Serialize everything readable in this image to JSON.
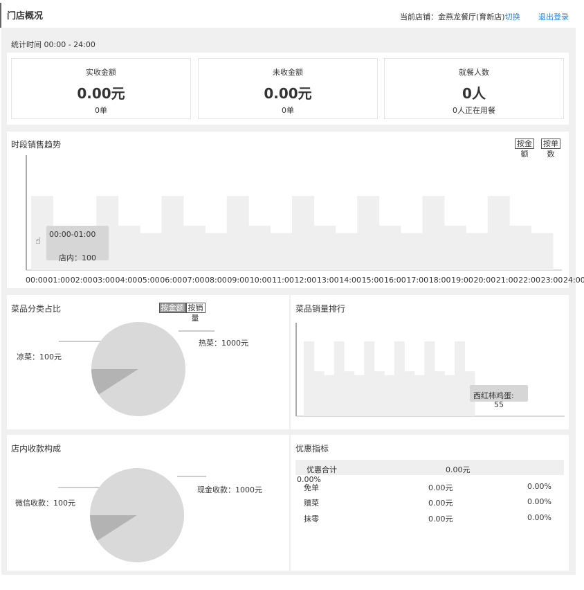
{
  "header": {
    "title": "门店概况",
    "store_label": "当前店铺：金燕龙餐厅(育新店)",
    "switch_label": "切换",
    "logout_label": "退出登录"
  },
  "stats": {
    "time_range": "统计时间 00:00 - 24:00",
    "cards": [
      {
        "title": "实收金额",
        "value": "0.00元",
        "sub": "0单"
      },
      {
        "title": "未收金额",
        "value": "0.00元",
        "sub": "0单"
      },
      {
        "title": "就餐人数",
        "value": "0人",
        "sub": "0人正在用餐"
      }
    ]
  },
  "trend": {
    "title": "时段销售趋势",
    "toggle_amount": "按金额",
    "toggle_count": "按单数",
    "tooltip_time": "00:00-01:00",
    "tooltip_value": "店内：100",
    "chart_data": {
      "type": "bar",
      "categories": [
        "00:00",
        "01:00",
        "02:00",
        "03:00",
        "04:00",
        "05:00",
        "06:00",
        "07:00",
        "08:00",
        "09:00",
        "10:00",
        "11:00",
        "12:00",
        "13:00",
        "14:00",
        "15:00",
        "16:00",
        "17:00",
        "18:00",
        "19:00",
        "20:00",
        "21:00",
        "22:00",
        "23:00"
      ],
      "values": [
        100,
        60,
        50,
        100,
        60,
        50,
        100,
        60,
        50,
        100,
        60,
        50,
        100,
        60,
        50,
        100,
        60,
        50,
        100,
        60,
        50,
        100,
        60,
        50
      ],
      "x_ticks": [
        "00:00",
        "01:00",
        "02:00",
        "03:00",
        "04:00",
        "05:00",
        "06:00",
        "07:00",
        "08:00",
        "09:00",
        "10:00",
        "11:00",
        "12:00",
        "13:00",
        "14:00",
        "15:00",
        "16:00",
        "17:00",
        "18:00",
        "19:00",
        "20:00",
        "21:00",
        "22:00",
        "23:00",
        "24:00"
      ]
    }
  },
  "category": {
    "title": "菜品分类占比",
    "toggle_amount": "按金额",
    "toggle_qty": "按销量",
    "chart_data": {
      "type": "pie",
      "labels": [
        "热菜：1000元",
        "凉菜：100元"
      ],
      "values": [
        1000,
        100
      ]
    }
  },
  "ranking": {
    "title": "菜品销量排行",
    "tooltip_name": "西红柿鸡蛋:",
    "tooltip_value": "55",
    "chart_data": {
      "type": "bar",
      "values": [
        100,
        60,
        55,
        100,
        60,
        55,
        100,
        60,
        55,
        100,
        60,
        55,
        100,
        60,
        55,
        100,
        60
      ]
    }
  },
  "payment": {
    "title": "店内收款构成",
    "chart_data": {
      "type": "pie",
      "labels": [
        "现金收款：1000元",
        "微信收款：100元"
      ],
      "values": [
        1000,
        100
      ]
    }
  },
  "discount": {
    "title": "优惠指标",
    "total_label": "优惠合计",
    "total_value": "0.00元",
    "total_pct": "0.00%",
    "rows": [
      {
        "name": "免单",
        "value": "0.00元",
        "pct": "0.00%"
      },
      {
        "name": "赠菜",
        "value": "0.00元",
        "pct": "0.00%"
      },
      {
        "name": "抹零",
        "value": "0.00元",
        "pct": "0.00%"
      }
    ]
  }
}
